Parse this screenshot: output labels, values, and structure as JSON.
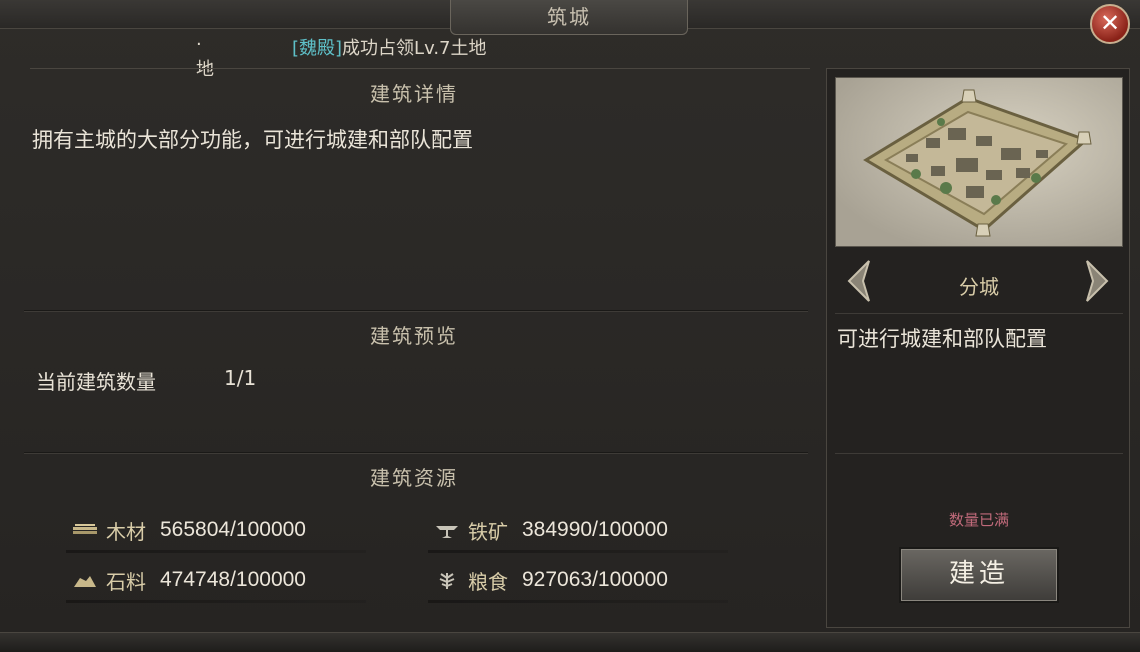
{
  "window": {
    "title": "筑城",
    "close_glyph": "✕"
  },
  "notice": {
    "left_text": "·地",
    "faction": "[魏殿]",
    "message": "成功占领Lv.7土地"
  },
  "sections": {
    "detail_title": "建筑详情",
    "detail_text": "拥有主城的大部分功能，可进行城建和部队配置",
    "preview_title": "建筑预览",
    "count_label": "当前建筑数量",
    "count_value": "1/1",
    "resource_title": "建筑资源"
  },
  "resources": [
    {
      "icon": "wood-icon",
      "name": "木材",
      "value": "565804/100000"
    },
    {
      "icon": "iron-icon",
      "name": "铁矿",
      "value": "384990/100000"
    },
    {
      "icon": "stone-icon",
      "name": "石料",
      "value": "474748/100000"
    },
    {
      "icon": "grain-icon",
      "name": "粮食",
      "value": "927063/100000"
    }
  ],
  "panel": {
    "city_name": "分城",
    "city_desc": "可进行城建和部队配置",
    "limit_text": "数量已满",
    "build_label": "建造"
  },
  "colors": {
    "faction": "#5ec0c8",
    "limit": "#c06a7a",
    "close_button": "#a83426"
  }
}
